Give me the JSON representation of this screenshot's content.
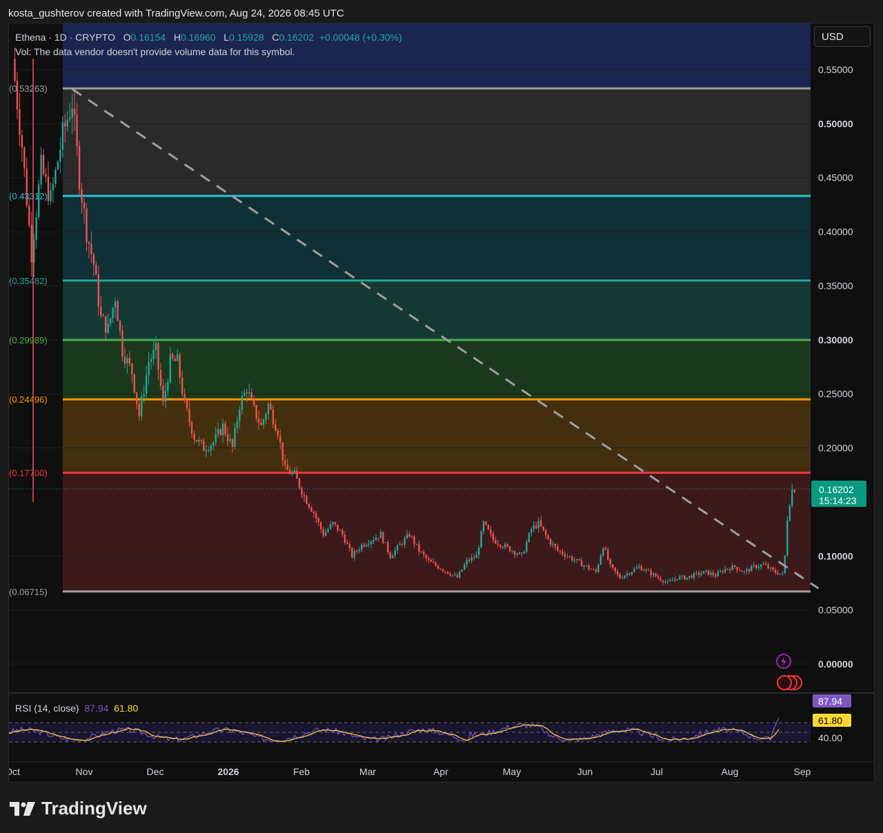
{
  "header": {
    "caption": "kosta_gushterov created with TradingView.com, Aug 24, 2026 08:45 UTC"
  },
  "legend": {
    "symbol": "Ethena · 1D · CRYPTO",
    "open_label": "O",
    "open": "0.16154",
    "high_label": "H",
    "high": "0.16960",
    "low_label": "L",
    "low": "0.15928",
    "close_label": "C",
    "close": "0.16202",
    "change": "+0.00048 (+0.30%)",
    "volume_note": "Vol: The data vendor doesn't provide volume data for this symbol."
  },
  "currency_button": "USD",
  "rsi_legend": {
    "label": "RSI (14, close)",
    "rsi_value": "87.94",
    "ma_value": "61.80"
  },
  "footer": {
    "brand": "TradingView"
  },
  "colors": {
    "up": "#26a69a",
    "down": "#ef5350",
    "rsi": "#7e57c2",
    "rsi_ma": "#fdd835",
    "level_0532": "#9e9e9e",
    "level_0433": "#26c6da",
    "level_0354": "#26a69a",
    "level_0300": "#4caf50",
    "level_0245": "#ff9800",
    "level_0177": "#f23645",
    "level_0067": "#9e9e9e"
  },
  "chart_data": {
    "type": "candlestick",
    "y_axis": {
      "ticks": [
        "0.55000",
        "0.50000",
        "0.45000",
        "0.40000",
        "0.35000",
        "0.30000",
        "0.25000",
        "0.20000",
        "0.10000",
        "0.05000",
        "0.00000"
      ],
      "range": [
        -0.01,
        0.59
      ]
    },
    "x_axis": {
      "ticks": [
        "Oct",
        "Nov",
        "Dec",
        "2026",
        "Feb",
        "Mar",
        "Apr",
        "May",
        "Jun",
        "Jul",
        "Aug",
        "Sep"
      ]
    },
    "fib_levels": [
      {
        "label": "(0.53263)",
        "value": 0.53263,
        "color": "#9e9e9e"
      },
      {
        "label": "(0.43312)",
        "value": 0.43312,
        "color": "#26c6da"
      },
      {
        "label": "(0.35482)",
        "value": 0.35482,
        "color": "#26a69a"
      },
      {
        "label": "(0.29989)",
        "value": 0.29989,
        "color": "#4caf50"
      },
      {
        "label": "(0.24496)",
        "value": 0.24496,
        "color": "#ff9800"
      },
      {
        "label": "(0.17700)",
        "value": 0.177,
        "color": "#f23645"
      },
      {
        "label": "(0.06715)",
        "value": 0.06715,
        "color": "#9e9e9e"
      }
    ],
    "current_price": {
      "value": 0.16202,
      "label": "0.16202",
      "countdown": "15:14:23"
    },
    "trendline": {
      "from": {
        "date": "2025-10-26",
        "price": 0.532
      },
      "to": {
        "date": "2026-09-03",
        "price": 0.07
      },
      "style": "dashed"
    },
    "price_path": [
      [
        "2025-10-01",
        0.56
      ],
      [
        "2025-10-05",
        0.48
      ],
      [
        "2025-10-09",
        0.38
      ],
      [
        "2025-10-13",
        0.46
      ],
      [
        "2025-10-17",
        0.43
      ],
      [
        "2025-10-22",
        0.49
      ],
      [
        "2025-10-26",
        0.52
      ],
      [
        "2025-10-29",
        0.45
      ],
      [
        "2025-11-01",
        0.4
      ],
      [
        "2025-11-04",
        0.37
      ],
      [
        "2025-11-07",
        0.32
      ],
      [
        "2025-11-10",
        0.31
      ],
      [
        "2025-11-13",
        0.34
      ],
      [
        "2025-11-16",
        0.29
      ],
      [
        "2025-11-20",
        0.27
      ],
      [
        "2025-11-23",
        0.23
      ],
      [
        "2025-11-27",
        0.28
      ],
      [
        "2025-11-30",
        0.29
      ],
      [
        "2025-12-03",
        0.24
      ],
      [
        "2025-12-06",
        0.28
      ],
      [
        "2025-12-09",
        0.28
      ],
      [
        "2025-12-12",
        0.24
      ],
      [
        "2025-12-16",
        0.21
      ],
      [
        "2025-12-20",
        0.2
      ],
      [
        "2025-12-24",
        0.205
      ],
      [
        "2025-12-28",
        0.22
      ],
      [
        "2026-01-01",
        0.2
      ],
      [
        "2026-01-04",
        0.24
      ],
      [
        "2026-01-07",
        0.255
      ],
      [
        "2026-01-10",
        0.235
      ],
      [
        "2026-01-13",
        0.22
      ],
      [
        "2026-01-16",
        0.24
      ],
      [
        "2026-01-20",
        0.215
      ],
      [
        "2026-01-23",
        0.18
      ],
      [
        "2026-01-27",
        0.175
      ],
      [
        "2026-01-31",
        0.155
      ],
      [
        "2026-02-04",
        0.14
      ],
      [
        "2026-02-08",
        0.12
      ],
      [
        "2026-02-12",
        0.13
      ],
      [
        "2026-02-16",
        0.12
      ],
      [
        "2026-02-20",
        0.1
      ],
      [
        "2026-02-24",
        0.11
      ],
      [
        "2026-02-28",
        0.115
      ],
      [
        "2026-03-04",
        0.12
      ],
      [
        "2026-03-08",
        0.1
      ],
      [
        "2026-03-12",
        0.11
      ],
      [
        "2026-03-16",
        0.12
      ],
      [
        "2026-03-20",
        0.105
      ],
      [
        "2026-03-24",
        0.095
      ],
      [
        "2026-03-28",
        0.09
      ],
      [
        "2026-04-01",
        0.085
      ],
      [
        "2026-04-05",
        0.08
      ],
      [
        "2026-04-09",
        0.095
      ],
      [
        "2026-04-13",
        0.1
      ],
      [
        "2026-04-16",
        0.13
      ],
      [
        "2026-04-20",
        0.115
      ],
      [
        "2026-04-24",
        0.11
      ],
      [
        "2026-04-28",
        0.105
      ],
      [
        "2026-05-02",
        0.1
      ],
      [
        "2026-05-06",
        0.125
      ],
      [
        "2026-05-09",
        0.13
      ],
      [
        "2026-05-13",
        0.115
      ],
      [
        "2026-05-17",
        0.105
      ],
      [
        "2026-05-21",
        0.1
      ],
      [
        "2026-05-25",
        0.095
      ],
      [
        "2026-05-29",
        0.09
      ],
      [
        "2026-06-02",
        0.085
      ],
      [
        "2026-06-05",
        0.11
      ],
      [
        "2026-06-08",
        0.09
      ],
      [
        "2026-06-12",
        0.08
      ],
      [
        "2026-06-16",
        0.085
      ],
      [
        "2026-06-20",
        0.09
      ],
      [
        "2026-06-24",
        0.085
      ],
      [
        "2026-06-28",
        0.08
      ],
      [
        "2026-07-02",
        0.075
      ],
      [
        "2026-07-06",
        0.08
      ],
      [
        "2026-07-10",
        0.08
      ],
      [
        "2026-07-14",
        0.083
      ],
      [
        "2026-07-18",
        0.085
      ],
      [
        "2026-07-22",
        0.082
      ],
      [
        "2026-07-26",
        0.088
      ],
      [
        "2026-07-30",
        0.09
      ],
      [
        "2026-08-03",
        0.085
      ],
      [
        "2026-08-07",
        0.09
      ],
      [
        "2026-08-11",
        0.092
      ],
      [
        "2026-08-15",
        0.086
      ],
      [
        "2026-08-19",
        0.083
      ],
      [
        "2026-08-20",
        0.1
      ],
      [
        "2026-08-21",
        0.135
      ],
      [
        "2026-08-22",
        0.15
      ],
      [
        "2026-08-23",
        0.161
      ],
      [
        "2026-08-24",
        0.162
      ]
    ],
    "rsi": {
      "levels": [
        "40.00"
      ],
      "current": 87.94,
      "ma": 61.8,
      "range": [
        20,
        90
      ]
    }
  }
}
